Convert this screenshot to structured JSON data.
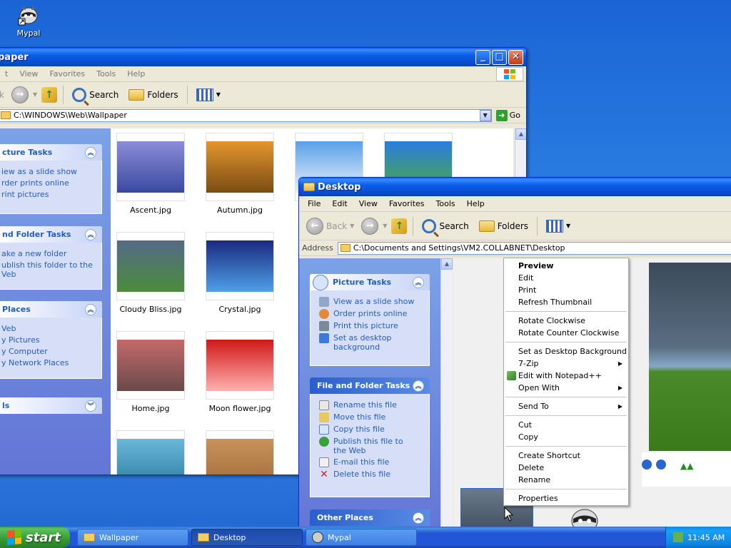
{
  "desktop": {
    "icon_label": "Mypal"
  },
  "wallpaper_window": {
    "title": "paper",
    "menu": [
      "t",
      "View",
      "Favorites",
      "Tools",
      "Help"
    ],
    "toolbar": {
      "back_label": "k",
      "search_label": "Search",
      "folders_label": "Folders"
    },
    "address": "C:\\WINDOWS\\Web\\Wallpaper",
    "go_label": "Go",
    "picture_tasks": {
      "title": "cture Tasks",
      "items": [
        "iew as a slide show",
        "rder prints online",
        "rint pictures"
      ]
    },
    "folder_tasks": {
      "title": "nd Folder Tasks",
      "items": [
        "ake a new folder",
        "ublish this folder to the",
        "Veb"
      ]
    },
    "other_places": {
      "title": "Places",
      "items": [
        "Veb",
        "y Pictures",
        "y Computer",
        "y Network Places"
      ]
    },
    "details": {
      "title": "ls"
    },
    "thumbnails": [
      {
        "label": "Ascent.jpg",
        "colors": [
          "#8c8cd8",
          "#3a4aa0"
        ]
      },
      {
        "label": "Autumn.jpg",
        "colors": [
          "#e3962e",
          "#7a4c14"
        ]
      },
      {
        "label": "",
        "colors": [
          "#5aa0e8",
          "#e8f2fb"
        ]
      },
      {
        "label": "",
        "colors": [
          "#2a7de1",
          "#4caa3a"
        ]
      },
      {
        "label": "Cloudy Bliss.jpg",
        "colors": [
          "#556a88",
          "#4a8c3a"
        ]
      },
      {
        "label": "Crystal.jpg",
        "colors": [
          "#1a2a80",
          "#4fa0e8"
        ]
      },
      {
        "label": "Home.jpg",
        "colors": [
          "#c46a6a",
          "#6a4a4a"
        ]
      },
      {
        "label": "Moon flower.jpg",
        "colors": [
          "#d01818",
          "#ffb0b0"
        ]
      },
      {
        "label": "",
        "colors": [
          "#6ab8d8",
          "#2a7aa0"
        ]
      },
      {
        "label": "",
        "colors": [
          "#c8925a",
          "#a06a3a"
        ]
      }
    ]
  },
  "desktop_window": {
    "title": "Desktop",
    "menu": [
      "File",
      "Edit",
      "View",
      "Favorites",
      "Tools",
      "Help"
    ],
    "toolbar": {
      "back_label": "Back",
      "search_label": "Search",
      "folders_label": "Folders"
    },
    "address_label": "Address",
    "address": "C:\\Documents and Settings\\VM2.COLLABNET\\Desktop",
    "picture_tasks": {
      "title": "Picture Tasks",
      "items": [
        "View as a slide show",
        "Order prints online",
        "Print this picture",
        "Set as desktop background"
      ]
    },
    "file_tasks": {
      "title": "File and Folder Tasks",
      "items": [
        "Rename this file",
        "Move this file",
        "Copy this file",
        "Publish this file to the Web",
        "E-mail this file",
        "Delete this file"
      ]
    },
    "other_places": {
      "title": "Other Places"
    }
  },
  "context_menu": {
    "groups": [
      [
        {
          "label": "Preview",
          "bold": true
        },
        {
          "label": "Edit"
        },
        {
          "label": "Print"
        },
        {
          "label": "Refresh Thumbnail"
        }
      ],
      [
        {
          "label": "Rotate Clockwise"
        },
        {
          "label": "Rotate Counter Clockwise"
        }
      ],
      [
        {
          "label": "Set as Desktop Background"
        },
        {
          "label": "7-Zip",
          "submenu": true
        },
        {
          "label": "Edit with Notepad++",
          "icon": true
        },
        {
          "label": "Open With",
          "submenu": true
        }
      ],
      [
        {
          "label": "Send To",
          "submenu": true
        }
      ],
      [
        {
          "label": "Cut"
        },
        {
          "label": "Copy"
        }
      ],
      [
        {
          "label": "Create Shortcut"
        },
        {
          "label": "Delete"
        },
        {
          "label": "Rename"
        }
      ],
      [
        {
          "label": "Properties"
        }
      ]
    ]
  },
  "taskbar": {
    "start_label": "start",
    "tasks": [
      "Wallpaper",
      "Desktop",
      "Mypal"
    ],
    "clock": "11:45 AM"
  }
}
